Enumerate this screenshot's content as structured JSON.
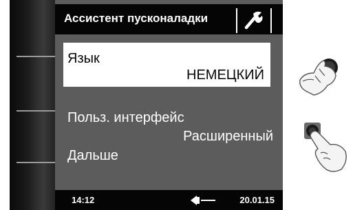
{
  "header": {
    "title": "Ассистент пусконаладки",
    "tool_icon": "wrench-icon"
  },
  "menu": {
    "items": [
      {
        "label": "Язык",
        "value": "НЕМЕЦКИЙ",
        "selected": true
      },
      {
        "label": "Польз. интерфейс",
        "value": "Расширенный",
        "selected": false
      },
      {
        "label": "Дальше",
        "value": "",
        "selected": false
      }
    ]
  },
  "footer": {
    "time": "14:12",
    "back_icon": "back-arrow-icon",
    "date": "20.01.15"
  },
  "instructions": {
    "rotate_icon": "rotate-knob-icon",
    "press_icon": "press-button-icon"
  },
  "colors": {
    "screen_bg": "#5c5c5c",
    "header_bg": "#050505",
    "selected_bg": "#ffffff",
    "text": "#ffffff"
  }
}
